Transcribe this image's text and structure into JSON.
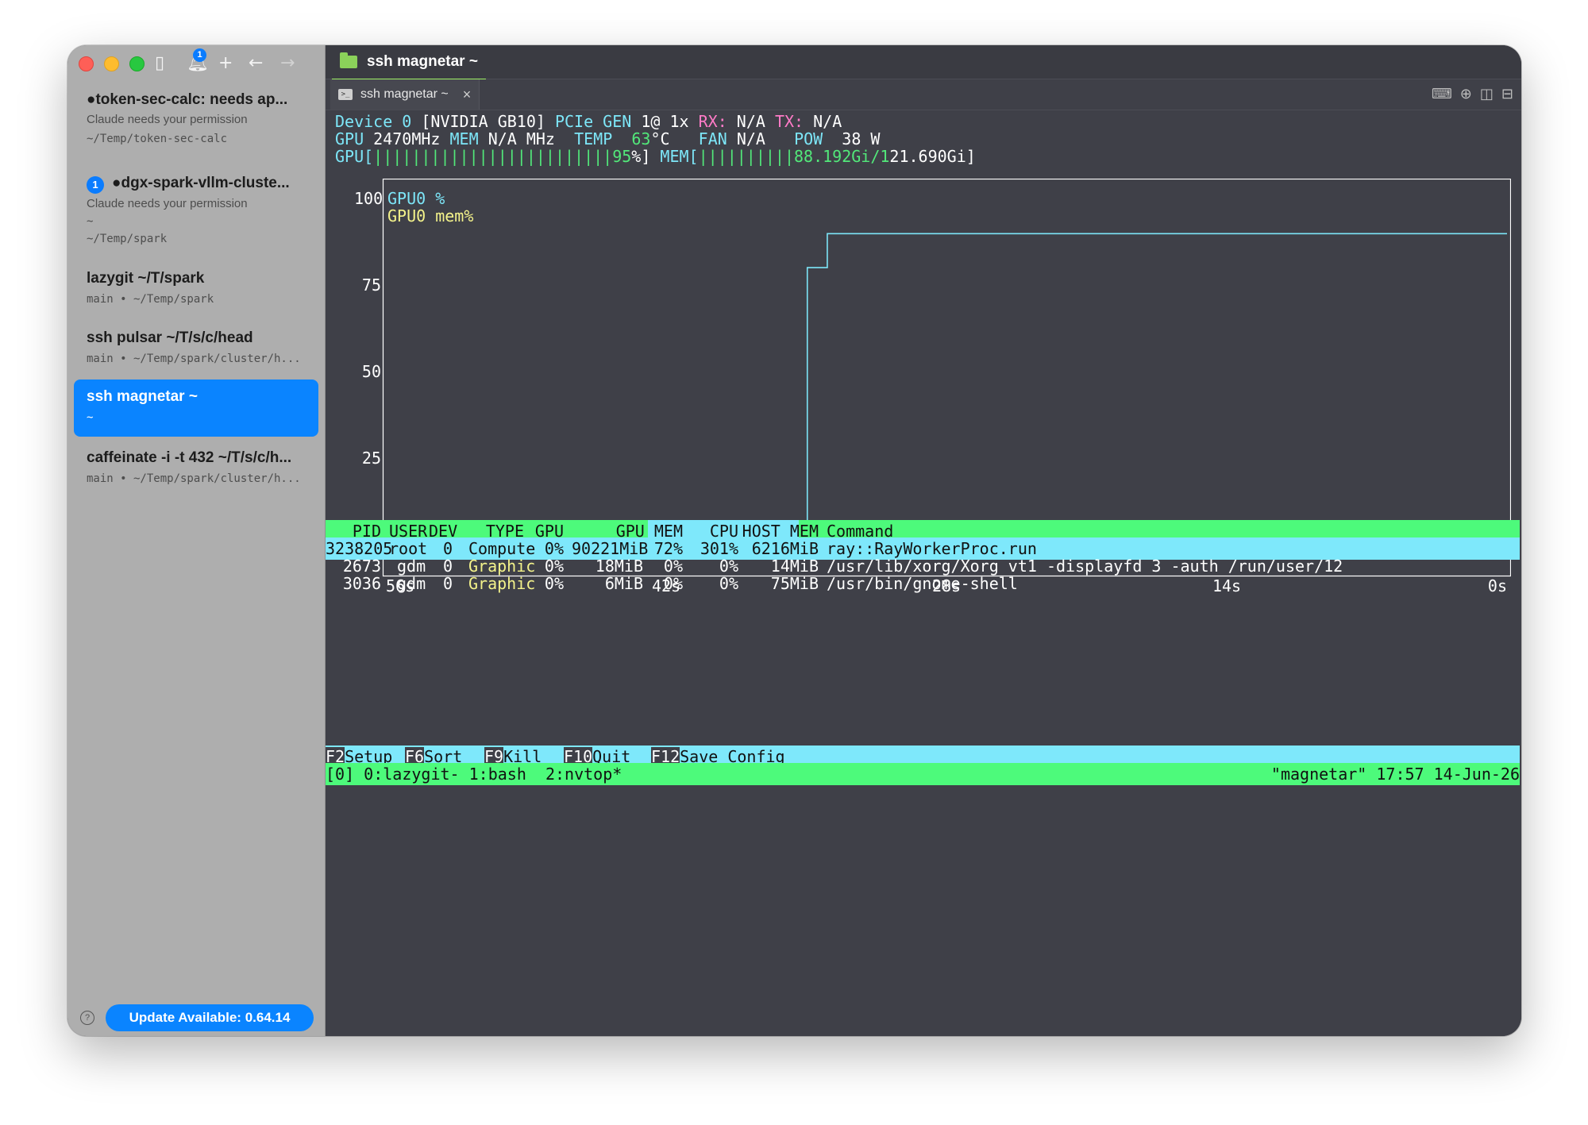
{
  "sidebar": {
    "bell_badge": "1",
    "workspaces": [
      {
        "title": "●token-sec-calc: needs ap...",
        "lines": [
          "Claude needs your permission",
          "~/Temp/token-sec-calc"
        ],
        "active": false
      },
      {
        "badge": "1",
        "title": "●dgx-spark-vllm-cluste...",
        "lines": [
          "Claude needs your permission",
          "~",
          "~/Temp/spark"
        ],
        "active": false
      },
      {
        "title": "lazygit ~/T/spark",
        "lines": [
          "main • ~/Temp/spark"
        ],
        "active": false
      },
      {
        "title": "ssh pulsar ~/T/s/c/head",
        "lines": [
          "main • ~/Temp/spark/cluster/h..."
        ],
        "active": false
      },
      {
        "title": "ssh magnetar ~",
        "lines": [
          "~"
        ],
        "active": true
      },
      {
        "title": "caffeinate -i -t 432 ~/T/s/c/h...",
        "lines": [
          "main • ~/Temp/spark/cluster/h..."
        ],
        "active": false
      }
    ],
    "update_label": "Update Available: 0.64.14"
  },
  "tabs": {
    "top_label": "ssh magnetar ~",
    "sub_label": "ssh magnetar ~"
  },
  "nvtop": {
    "device_line": {
      "device": "Device 0",
      "name": "[NVIDIA GB10]",
      "pcie_label": "PCIe GEN",
      "pcie_value": "1@ 1x",
      "rx_label": "RX:",
      "rx_value": "N/A",
      "tx_label": "TX:",
      "tx_value": "N/A"
    },
    "clock_line": {
      "gpu_label": "GPU",
      "gpu_value": "2470MHz",
      "mem_label": "MEM",
      "mem_value": "N/A MHz",
      "temp_label": "TEMP",
      "temp_value": "63",
      "temp_unit": "°C",
      "fan_label": "FAN",
      "fan_value": "N/A",
      "pow_label": "POW",
      "pow_value": "38 W"
    },
    "bars_line": {
      "gpu_label": "GPU[",
      "gpu_bars": "|||||||||||||||||||||||||95",
      "gpu_pct": "%]",
      "mem_label": "MEM[",
      "mem_bars": "||||||||||88.192Gi/1",
      "mem_rest": "21.690Gi]"
    }
  },
  "chart_data": {
    "type": "line",
    "ylim": [
      0,
      100
    ],
    "yticks": [
      "100",
      "75",
      "50",
      "25",
      "0"
    ],
    "xticks": [
      "56s",
      "42s",
      "28s",
      "14s",
      "0s"
    ],
    "legend": [
      "GPU0 %",
      "GPU0 mem%"
    ],
    "series": [
      {
        "name": "GPU0 %",
        "color": "#7de6f8",
        "x": [
          56,
          35,
          35,
          34,
          34,
          0
        ],
        "y": [
          0,
          0,
          85,
          85,
          95,
          95
        ]
      },
      {
        "name": "GPU0 mem%",
        "color": "#f4f38b",
        "x": [
          56,
          0
        ],
        "y": [
          0,
          0
        ]
      }
    ]
  },
  "process_table": {
    "headers": [
      "PID",
      "USER",
      "DEV",
      "TYPE",
      "GPU",
      "GPU MEM",
      "CPU",
      "HOST MEM",
      "Command"
    ],
    "rows": [
      {
        "pid": "3238205",
        "user": "root",
        "dev": "0",
        "type": "Compute",
        "gpu": "0%",
        "gpu_mem": "90221MiB",
        "gpu_mem_pct": "72%",
        "cpu": "301%",
        "host_mem": "6216MiB",
        "command": "ray::RayWorkerProc.run",
        "selected": true
      },
      {
        "pid": "2673",
        "user": "gdm",
        "dev": "0",
        "type": "Graphic",
        "gpu": "0%",
        "gpu_mem": "18MiB",
        "gpu_mem_pct": "0%",
        "cpu": "0%",
        "host_mem": "14MiB",
        "command": "/usr/lib/xorg/Xorg vt1 -displayfd 3 -auth /run/user/12",
        "selected": false
      },
      {
        "pid": "3036",
        "user": "gdm",
        "dev": "0",
        "type": "Graphic",
        "gpu": "0%",
        "gpu_mem": "6MiB",
        "gpu_mem_pct": "0%",
        "cpu": "0%",
        "host_mem": "75MiB",
        "command": "/usr/bin/gnome-shell",
        "selected": false
      }
    ]
  },
  "fkeys": [
    {
      "key": "F2",
      "label": "Setup"
    },
    {
      "key": "F6",
      "label": "Sort"
    },
    {
      "key": "F9",
      "label": "Kill"
    },
    {
      "key": "F10",
      "label": "Quit"
    },
    {
      "key": "F12",
      "label": "Save Config"
    }
  ],
  "tmux": {
    "left": "[0] 0:lazygit- 1:bash  2:nvtop*",
    "right": "\"magnetar\" 17:57 14-Jun-26"
  },
  "colors": {
    "accent": "#0a84ff",
    "terminal_bg": "#3f4048",
    "green": "#4dfa7b",
    "cyan": "#7ee8fb"
  }
}
